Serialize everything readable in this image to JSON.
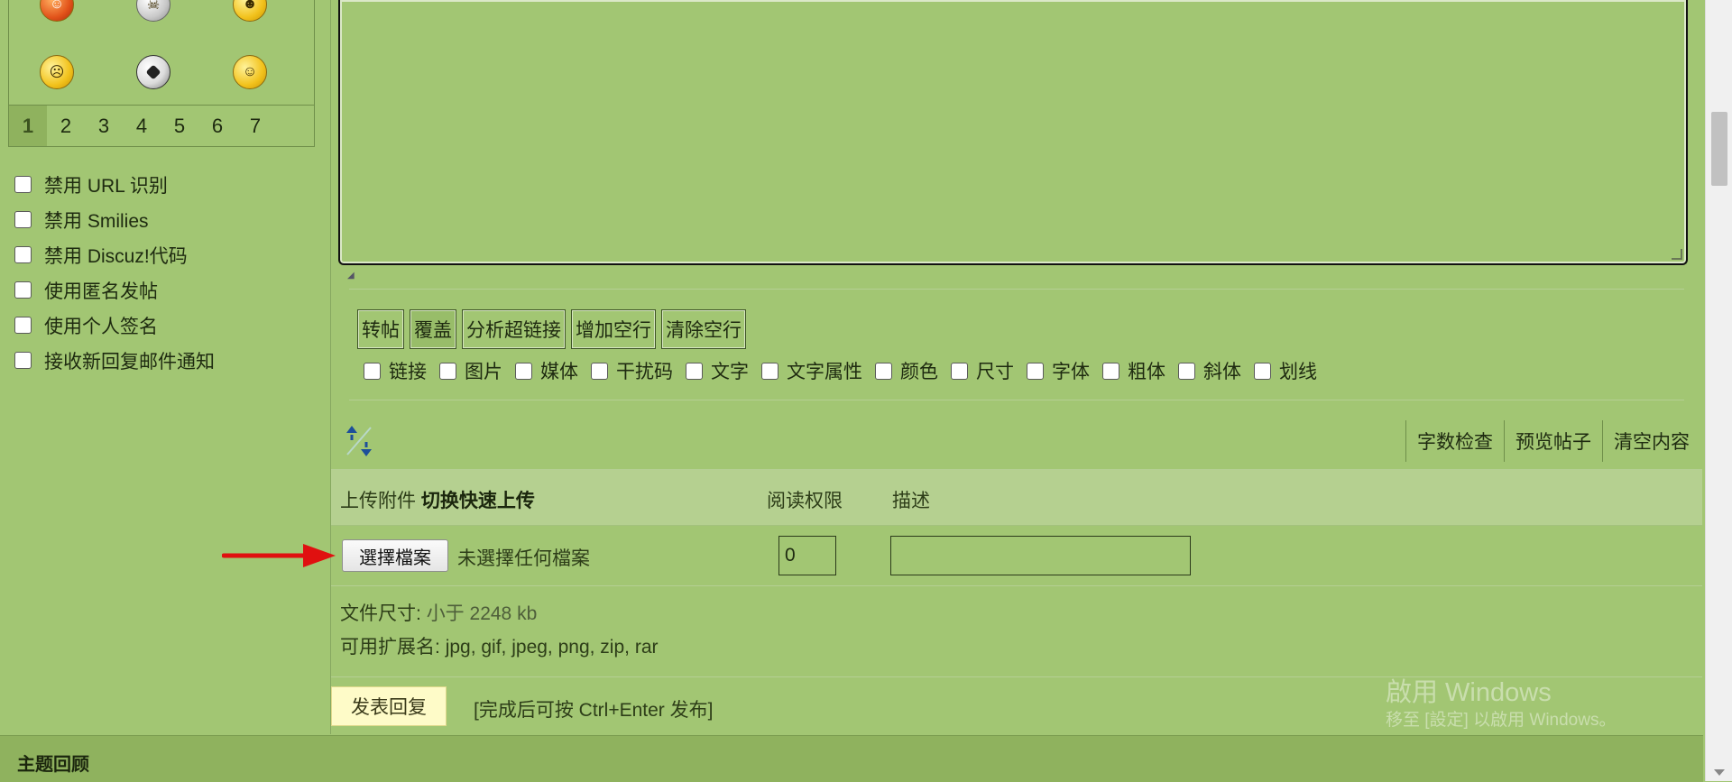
{
  "smilies": {
    "row1": [
      "devil-smiley-icon",
      "skull-smiley-icon",
      "cool-smiley-icon"
    ],
    "row2": [
      "angry-smiley-icon",
      "soccer-ball-icon",
      "sleepy-smiley-icon"
    ],
    "pages": [
      "1",
      "2",
      "3",
      "4",
      "5",
      "6",
      "7"
    ],
    "active_page": "1"
  },
  "options": [
    {
      "label": "禁用 URL 识别",
      "checked": false
    },
    {
      "label": "禁用 Smilies",
      "checked": false
    },
    {
      "label": "禁用 Discuz!代码",
      "checked": false
    },
    {
      "label": "使用匿名发帖",
      "checked": false
    },
    {
      "label": "使用个人签名",
      "checked": false
    },
    {
      "label": "接收新回复邮件通知",
      "checked": false
    }
  ],
  "toolbar": {
    "buttons": [
      "转帖",
      "覆盖",
      "分析超链接",
      "增加空行",
      "清除空行"
    ],
    "checks": [
      "链接",
      "图片",
      "媒体",
      "干扰码",
      "文字",
      "文字属性",
      "颜色",
      "尺寸",
      "字体",
      "粗体",
      "斜体",
      "划线"
    ]
  },
  "footer_actions": [
    "字数检查",
    "预览帖子",
    "清空内容"
  ],
  "upload": {
    "col_upload": "上传附件",
    "col_quick": "切换快速上传",
    "col_perm": "阅读权限",
    "col_desc": "描述",
    "file_button": "選擇檔案",
    "file_status": "未選擇任何檔案",
    "perm_value": "0",
    "desc_value": ""
  },
  "file_info": {
    "size_label": "文件尺寸:",
    "size_value": "小于 2248 kb",
    "ext_label": "可用扩展名:",
    "ext_value": "jpg, gif, jpeg, png, zip, rar"
  },
  "submit": {
    "button": "发表回复",
    "hint": "[完成后可按 Ctrl+Enter 发布]"
  },
  "section_title": "主题回顾",
  "watermark": {
    "line1": "啟用 Windows",
    "line2": "移至 [設定] 以啟用 Windows。"
  },
  "colors": {
    "page_bg": "#a2c673",
    "header_bg": "#b5d090",
    "section_bg": "#8fb25e",
    "submit_bg": "#fefbc8",
    "arrow": "#e01010"
  }
}
